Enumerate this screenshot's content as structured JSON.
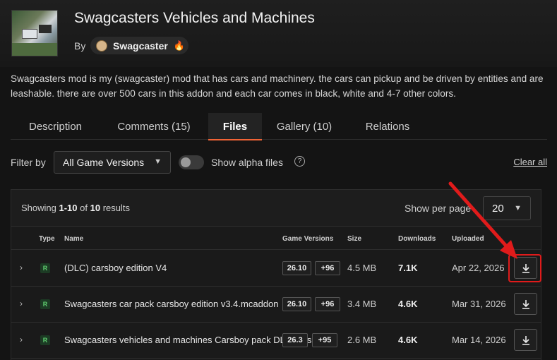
{
  "header": {
    "title": "Swagcasters Vehicles and Machines",
    "by_label": "By",
    "author": "Swagcaster",
    "description": "Swagcasters mod is my (swagcaster) mod that has cars and machinery. the cars can pickup and be driven by entities and are leashable. there are over 500 cars in this addon and each car comes in black, white and 4-7 other colors."
  },
  "tabs": [
    {
      "label": "Description"
    },
    {
      "label": "Comments (15)"
    },
    {
      "label": "Files"
    },
    {
      "label": "Gallery (10)"
    },
    {
      "label": "Relations"
    }
  ],
  "filter": {
    "label": "Filter by",
    "game_version": "All Game Versions",
    "alpha_label": "Show alpha files",
    "help_glyph": "?",
    "clear_all": "Clear all"
  },
  "table": {
    "showing_prefix": "Showing",
    "showing_range": "1-10",
    "showing_of": "of",
    "showing_total": "10",
    "showing_suffix": "results",
    "per_page_label": "Show per page",
    "per_page_value": "20",
    "columns": {
      "type": "Type",
      "name": "Name",
      "game_versions": "Game Versions",
      "size": "Size",
      "downloads": "Downloads",
      "uploaded": "Uploaded"
    },
    "rows": [
      {
        "type": "R",
        "name": "(DLC) carsboy edition V4",
        "version": "26.10",
        "more": "+96",
        "size": "4.5 MB",
        "downloads": "7.1K",
        "uploaded": "Apr 22, 2026"
      },
      {
        "type": "R",
        "name": "Swagcasters car pack carsboy edition v3.4.mcaddon",
        "version": "26.10",
        "more": "+96",
        "size": "3.4 MB",
        "downloads": "4.6K",
        "uploaded": "Mar 31, 2026"
      },
      {
        "type": "R",
        "name": "Swagcasters vehicles and machines Carsboy pack DLC version 3",
        "version": "26.3",
        "more": "+95",
        "size": "2.6 MB",
        "downloads": "4.6K",
        "uploaded": "Mar 14, 2026"
      }
    ]
  },
  "colors": {
    "accent": "#f16436",
    "highlight": "#e01b1b",
    "release_badge": "#5fcf6f"
  }
}
